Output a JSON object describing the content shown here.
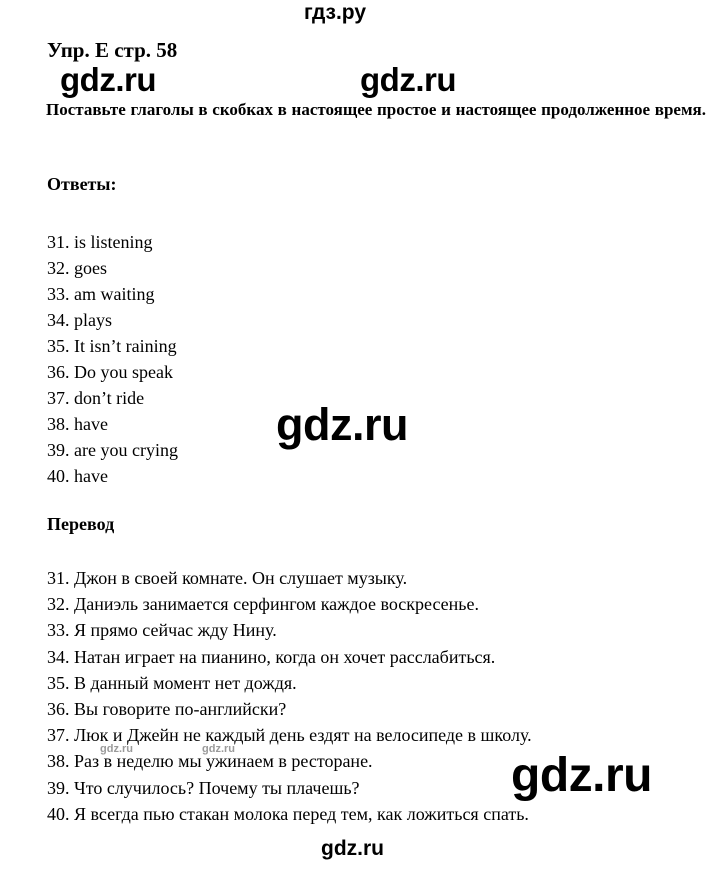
{
  "page": {
    "background_color": "#ffffff",
    "text_color": "#000000"
  },
  "watermarks": {
    "top": "гдз.ру",
    "mid_left": "gdz.ru",
    "mid_right": "gdz.ru",
    "center": "gdz.ru",
    "bottom_right": "gdz.ru",
    "bottom_center": "gdz.ru",
    "small_left": "gdz.ru",
    "small_right": "gdz.ru",
    "small_color": "#9a9a9a"
  },
  "exercise": {
    "title": "Упр. E стр. 58",
    "task": "Поставьте глаголы в скобках в настоящее простое и настоящее продолженное время."
  },
  "answers": {
    "heading": "Ответы:",
    "items": [
      {
        "num": "31.",
        "text": "is listening"
      },
      {
        "num": "32.",
        "text": "goes"
      },
      {
        "num": "33.",
        "text": "am waiting"
      },
      {
        "num": "34.",
        "text": "plays"
      },
      {
        "num": "35.",
        "text": "It isn’t raining"
      },
      {
        "num": "36.",
        "text": "Do you speak"
      },
      {
        "num": "37.",
        "text": "don’t ride"
      },
      {
        "num": "38.",
        "text": "have"
      },
      {
        "num": "39.",
        "text": "are you crying"
      },
      {
        "num": "40.",
        "text": "have"
      }
    ]
  },
  "translation": {
    "heading": "Перевод",
    "items": [
      {
        "num": "31.",
        "text": "Джон в своей комнате. Он слушает музыку."
      },
      {
        "num": "32.",
        "text": "Даниэль занимается серфингом каждое воскресенье."
      },
      {
        "num": "33.",
        "text": "Я прямо сейчас жду Нину."
      },
      {
        "num": "34.",
        "text": "Натан играет на пианино, когда он хочет расслабиться."
      },
      {
        "num": "35.",
        "text": "В данный момент нет дождя."
      },
      {
        "num": "36.",
        "text": "Вы говорите по-английски?"
      },
      {
        "num": "37.",
        "text": "Люк и Джейн не каждый день ездят на велосипеде в школу."
      },
      {
        "num": "38.",
        "text": "Раз в неделю мы ужинаем в ресторане."
      },
      {
        "num": "39.",
        "text": "Что случилось? Почему ты плачешь?"
      },
      {
        "num": "40.",
        "text": "Я всегда пью стакан молока перед тем, как ложиться спать."
      }
    ]
  }
}
